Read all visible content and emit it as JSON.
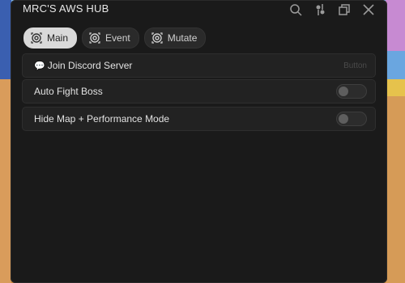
{
  "window": {
    "title": "MRC'S AWS HUB"
  },
  "titlebar_icons": [
    "search-icon",
    "settings-icon",
    "minimize-icon",
    "close-icon"
  ],
  "tabs": [
    {
      "label": "Main",
      "icon": "target-icon",
      "active": true
    },
    {
      "label": "Event",
      "icon": "target-icon",
      "active": false
    },
    {
      "label": "Mutate",
      "icon": "target-icon",
      "active": false
    }
  ],
  "rows": [
    {
      "label": "Join Discord Server",
      "icon": "chat-icon",
      "hint": "Button",
      "type": "button"
    },
    {
      "label": "Auto Fight Boss",
      "type": "toggle",
      "enabled": false
    },
    {
      "label": "Hide Map + Performance Mode",
      "type": "toggle",
      "enabled": false
    }
  ],
  "colors": {
    "panel": "#1a1a1a",
    "row": "#222222",
    "active_tab": "#d9d9d9"
  }
}
